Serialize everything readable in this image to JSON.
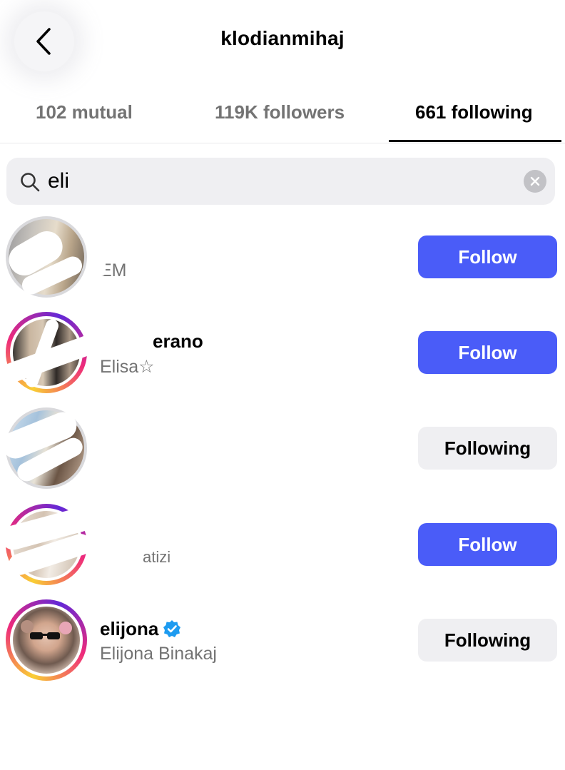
{
  "header": {
    "title": "klodianmihaj"
  },
  "tabs": [
    {
      "label": "102 mutual",
      "active": false
    },
    {
      "label": "119K followers",
      "active": false
    },
    {
      "label": "661 following",
      "active": true
    }
  ],
  "search": {
    "value": "eli",
    "icon": "search-icon",
    "clear_icon": "clear-icon"
  },
  "users": [
    {
      "username": "",
      "full_name": "EM",
      "button": "Follow",
      "ring": false
    },
    {
      "username": "erano",
      "full_name": "Elisa☆",
      "button": "Follow",
      "ring": true
    },
    {
      "username": "",
      "full_name": "",
      "button": "Following",
      "ring": false
    },
    {
      "username": "",
      "full_name": "atizi",
      "button": "Follow",
      "ring": true
    },
    {
      "username": "elijona",
      "full_name": "Elijona Binakaj",
      "button": "Following",
      "ring": true,
      "verified": true
    }
  ],
  "colors": {
    "follow_button": "#4a5cf8",
    "following_button": "#efeff2",
    "verified_badge": "#1d9bf0"
  }
}
